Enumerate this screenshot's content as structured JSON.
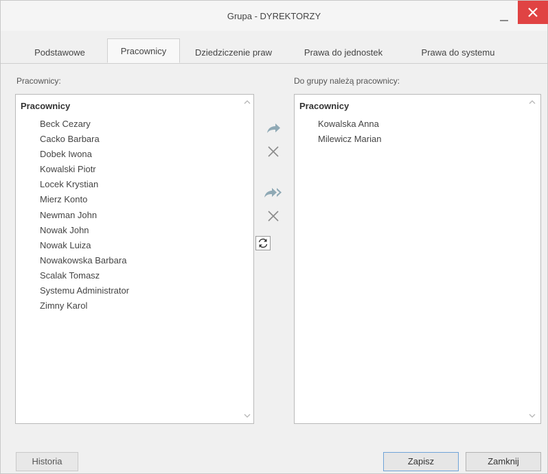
{
  "window": {
    "title": "Grupa - DYREKTORZY"
  },
  "tabs": [
    {
      "label": "Podstawowe"
    },
    {
      "label": "Pracownicy"
    },
    {
      "label": "Dziedziczenie praw"
    },
    {
      "label": "Prawa do jednostek"
    },
    {
      "label": "Prawa do systemu"
    }
  ],
  "left": {
    "label": "Pracownicy:",
    "group": "Pracownicy",
    "items": [
      "Beck Cezary",
      "Cacko Barbara",
      "Dobek Iwona",
      "Kowalski Piotr",
      "Locek Krystian",
      "Mierz Konto",
      "Newman John",
      "Nowak John",
      "Nowak Luiza",
      "Nowakowska Barbara",
      "Scalak Tomasz",
      "Systemu Administrator",
      "Zimny Karol"
    ]
  },
  "right": {
    "label": "Do grupy należą pracownicy:",
    "group": "Pracownicy",
    "items": [
      "Kowalska Anna",
      "Milewicz Marian"
    ]
  },
  "controls": {
    "icons": [
      "arrow-right-icon",
      "remove-icon",
      "double-arrow-right-icon",
      "remove-all-icon",
      "refresh-icon"
    ]
  },
  "footer": {
    "historia": "Historia",
    "zapisz": "Zapisz",
    "zamknij": "Zamknij"
  },
  "colors": {
    "close": "#e04343",
    "arrow": "#8fa9b5",
    "focus_border": "#6fa3d8"
  }
}
